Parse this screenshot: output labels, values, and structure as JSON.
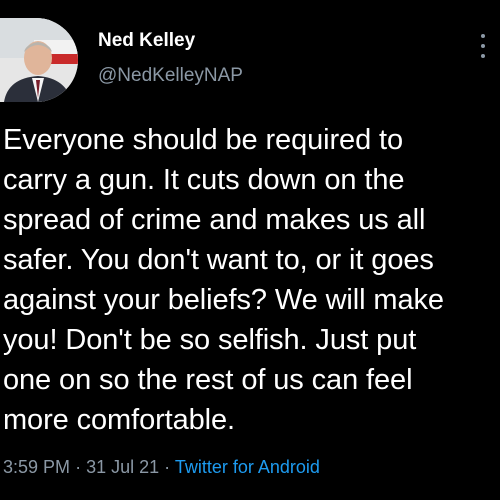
{
  "tweet": {
    "author": {
      "display_name": "Ned Kelley",
      "handle": "@NedKelleyNAP",
      "avatar_icon": "profile-photo"
    },
    "text": "Everyone should be required to\ncarry a gun. It cuts down on the\nspread of crime and makes us all\nsafer. You don't want to, or it goes\nagainst your beliefs? We will make\nyou! Don't be so selfish. Just put\none on so the rest of us can feel\nmore comfortable.",
    "time": "3:59 PM",
    "separator": "·",
    "date": "31 Jul 21",
    "source": "Twitter for Android",
    "more_icon": "more-vertical-icon"
  },
  "colors": {
    "background": "#000000",
    "text": "#ffffff",
    "secondary": "#8b98a5",
    "link": "#1d9bf0"
  }
}
